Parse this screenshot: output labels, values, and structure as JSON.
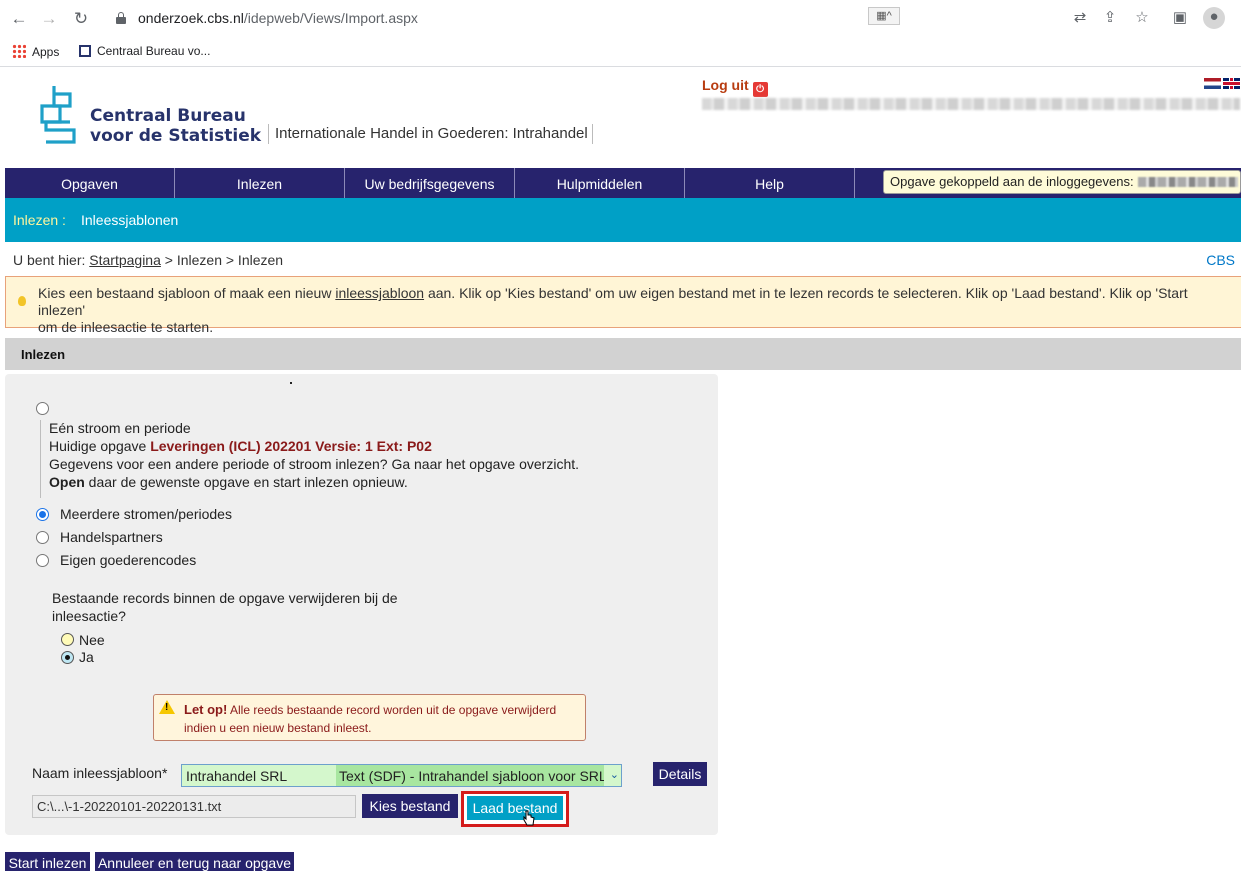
{
  "browser": {
    "url_host": "onderzoek.cbs.nl",
    "url_path": "/idepweb/Views/Import.aspx",
    "bookmarks": [
      "Apps",
      "Centraal Bureau vo..."
    ]
  },
  "header": {
    "logo_line1": "Centraal Bureau",
    "logo_line2": "voor de Statistiek",
    "app_name": "Internationale Handel in Goederen: Intrahandel",
    "logout": "Log uit"
  },
  "menu": {
    "items": [
      "Opgaven",
      "Inlezen",
      "Uw bedrijfsgegevens",
      "Hulpmiddelen",
      "Help"
    ],
    "tooltip": "Opgave gekoppeld aan de inloggegevens:"
  },
  "subnav": {
    "section": "Inlezen :",
    "current": "Inleessjablonen"
  },
  "breadcrumb": {
    "prefix": "U bent hier:",
    "home": "Startpagina",
    "rest": "> Inlezen > Inlezen",
    "right": "CBS"
  },
  "hint": {
    "part1": "Kies een bestaand sjabloon of maak een nieuw",
    "link": "inleessjabloon",
    "part2": "aan. Klik op 'Kies bestand' om uw eigen bestand met in te lezen records te selecteren. Klik op 'Laad bestand'. Klik op 'Start inlezen'",
    "part3": "om de inleesactie te starten."
  },
  "section_title": "Inlezen",
  "form": {
    "single_stream_label": "Eén stroom en periode",
    "current_prefix": "Huidige opgave",
    "current_value": "Leveringen (ICL) 202201 Versie: 1 Ext: P02",
    "other_prefix": "Gegevens voor een andere periode of stroom inlezen? Ga naar het",
    "other_link": "opgave overzicht",
    "open_bold": "Open",
    "open_rest": "daar de gewenste opgave en start inlezen opnieuw.",
    "options": [
      "Meerdere stromen/periodes",
      "Handelspartners",
      "Eigen goederencodes"
    ],
    "question_line1": "Bestaande records binnen de opgave verwijderen bij de",
    "question_line2": "inleesactie?",
    "answer_no": "Nee",
    "answer_yes": "Ja",
    "warning_title": "Let op!",
    "warning_line1": "Alle reeds bestaande record worden uit de opgave verwijderd",
    "warning_line2": "indien u een nieuw bestand inleest.",
    "template_label": "Naam inleessjabloon*",
    "template_name": "Intrahandel SRL",
    "template_type": "Text (SDF) - Intrahandel sjabloon voor SRL",
    "details_button": "Details",
    "file_value": "C:\\...\\-1-20220101-20220131.txt",
    "choose_button": "Kies bestand",
    "load_button": "Laad bestand"
  },
  "footer_buttons": {
    "start": "Start inlezen",
    "cancel": "Annuleer en terug naar opgave"
  }
}
